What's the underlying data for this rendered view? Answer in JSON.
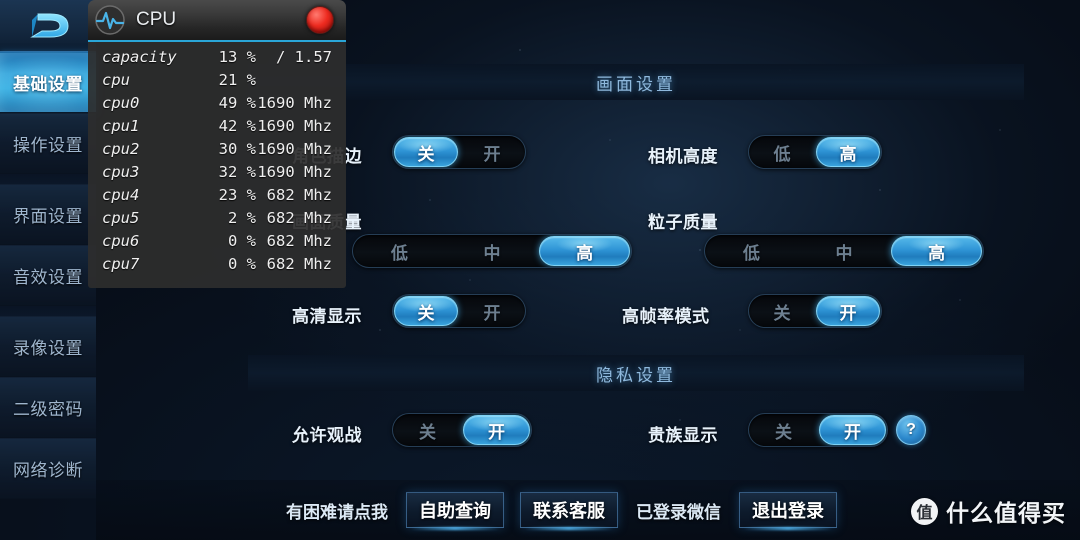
{
  "sidebar": {
    "logo": "game-logo",
    "items": [
      {
        "label": "基础设置",
        "selected": true
      },
      {
        "label": "操作设置",
        "selected": false
      },
      {
        "label": "界面设置",
        "selected": false
      },
      {
        "label": "音效设置",
        "selected": false
      },
      {
        "label": "录像设置",
        "selected": false
      },
      {
        "label": "二级密码",
        "selected": false
      },
      {
        "label": "网络诊断",
        "selected": false
      }
    ]
  },
  "sections": {
    "display": {
      "title": "画面设置",
      "rows": [
        {
          "label": "角色描边",
          "options": [
            "关",
            "开"
          ],
          "selected": "关"
        },
        {
          "label": "相机高度",
          "options": [
            "低",
            "高"
          ],
          "selected": "高"
        },
        {
          "label": "画面质量",
          "options": [
            "低",
            "中",
            "高"
          ],
          "selected": "高"
        },
        {
          "label": "粒子质量",
          "options": [
            "低",
            "中",
            "高"
          ],
          "selected": "高"
        },
        {
          "label": "高清显示",
          "options": [
            "关",
            "开"
          ],
          "selected": "关"
        },
        {
          "label": "高帧率模式",
          "options": [
            "关",
            "开"
          ],
          "selected": "开"
        }
      ]
    },
    "privacy": {
      "title": "隐私设置",
      "rows": [
        {
          "label": "允许观战",
          "options": [
            "关",
            "开"
          ],
          "selected": "开"
        },
        {
          "label": "贵族显示",
          "options": [
            "关",
            "开"
          ],
          "selected": "开"
        }
      ],
      "help_label": "?"
    }
  },
  "bottom_bar": {
    "help_text": "有困难请点我",
    "self_service_label": "自助查询",
    "contact_label": "联系客服",
    "wechat_status": "已登录微信",
    "logout_label": "退出登录"
  },
  "watermark": {
    "logo_char": "值",
    "text": "什么值得买"
  },
  "cpu_overlay": {
    "title": "CPU",
    "record_button": "record-dot",
    "rows": [
      {
        "name": "capacity",
        "pct": "13 %",
        "freq": "/ 1.57"
      },
      {
        "name": "cpu",
        "pct": "21 %",
        "freq": ""
      },
      {
        "name": "cpu0",
        "pct": "49 %",
        "freq": "1690 Mhz"
      },
      {
        "name": "cpu1",
        "pct": "42 %",
        "freq": "1690 Mhz"
      },
      {
        "name": "cpu2",
        "pct": "30 %",
        "freq": "1690 Mhz"
      },
      {
        "name": "cpu3",
        "pct": "32 %",
        "freq": "1690 Mhz"
      },
      {
        "name": "cpu4",
        "pct": "23 %",
        "freq": "682 Mhz"
      },
      {
        "name": "cpu5",
        "pct": "2 %",
        "freq": "682 Mhz"
      },
      {
        "name": "cpu6",
        "pct": "0 %",
        "freq": "682 Mhz"
      },
      {
        "name": "cpu7",
        "pct": "0 %",
        "freq": "682 Mhz"
      }
    ]
  },
  "colors": {
    "accent_blue": "#2f9fd6",
    "accent_light": "#56b9ea",
    "record_red": "#ee2b20",
    "header_text": "#8fb9dd"
  }
}
